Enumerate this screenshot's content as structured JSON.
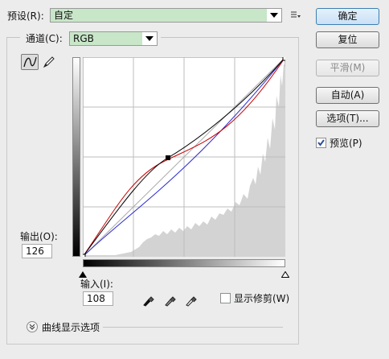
{
  "preset": {
    "label": "预设(R):",
    "value": "自定"
  },
  "channel": {
    "label": "通道(C):",
    "value": "RGB"
  },
  "buttons": {
    "ok": "确定",
    "reset": "复位",
    "smooth": "平滑(M)",
    "auto": "自动(A)",
    "options": "选项(T)..."
  },
  "preview": {
    "label": "预览(P)",
    "checked": true
  },
  "output": {
    "label": "输出(O):",
    "value": "126"
  },
  "input": {
    "label": "输入(I):",
    "value": "108"
  },
  "show_clipping": {
    "label": "显示修剪(W)",
    "checked": false
  },
  "curve_display_options": {
    "label": "曲线显示选项"
  },
  "icons": {
    "preset_menu": "preset-options-icon",
    "curve_tool": "curve-point-tool-icon",
    "pencil_tool": "pencil-tool-icon",
    "black_eyedropper": "black-point-eyedropper-icon",
    "gray_eyedropper": "gray-point-eyedropper-icon",
    "white_eyedropper": "white-point-eyedropper-icon",
    "expand": "expand-chevron-icon"
  },
  "colors": {
    "combo_highlight": "#c8e6c8",
    "histogram": "#d3d3d3",
    "curve_rgb": "#000000",
    "curve_red": "#cc0000",
    "curve_blue": "#2a2ad0"
  }
}
